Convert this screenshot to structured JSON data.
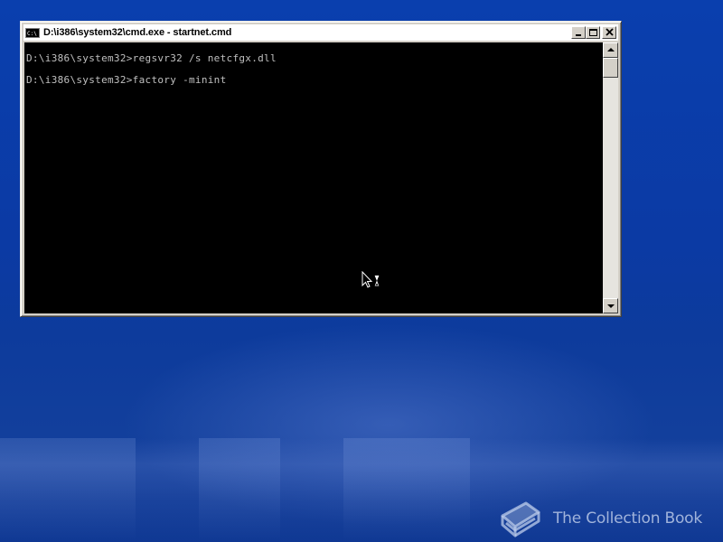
{
  "window": {
    "title": "D:\\i386\\system32\\cmd.exe - startnet.cmd",
    "icon": "console-icon",
    "icon_label": "C:\\"
  },
  "console": {
    "lines": [
      "D:\\i386\\system32>regsvr32 /s netcfgx.dll",
      "D:\\i386\\system32>factory -minint"
    ],
    "background": "#000000",
    "foreground": "#c0c0c0"
  },
  "cursor": {
    "icon": "busy-cursor-icon"
  },
  "watermark": {
    "text": "The Collection Book",
    "icon": "book-icon"
  },
  "colors": {
    "desktop_blue": "#0b3aa4",
    "titlebar": "#ffffff",
    "window_chrome": "#d4d0c8"
  }
}
